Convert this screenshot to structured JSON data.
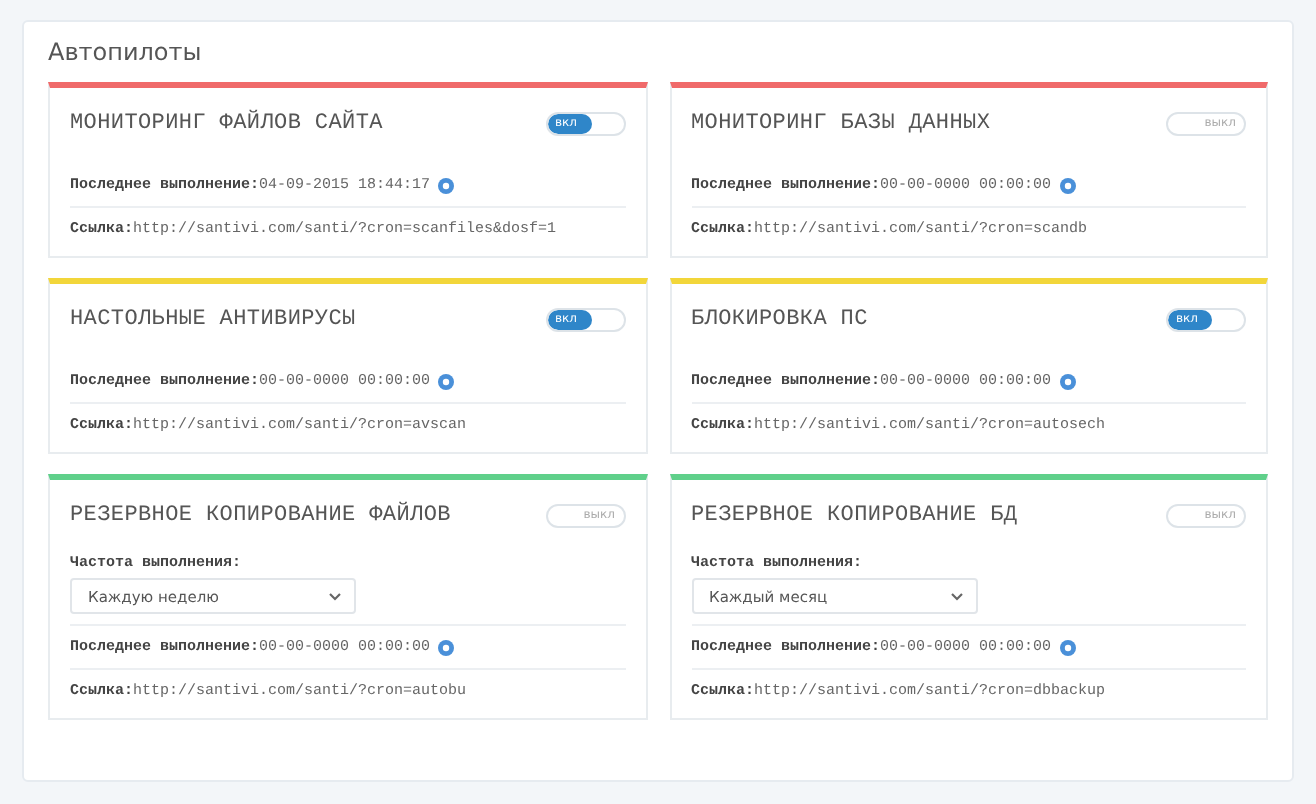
{
  "panel": {
    "title": "Автопилоты"
  },
  "cards": [
    {
      "title": "МОНИТОРИНГ ФАЙЛОВ САЙТА",
      "color": "#f06a6a",
      "toggle": {
        "on": true,
        "label": "вкл"
      },
      "last_run": {
        "label": "Последнее выполнение:",
        "value": "04-09-2015 18:44:17"
      },
      "link": {
        "label": "Ссылка:",
        "value": "http://santivi.com/santi/?cron=scanfiles&dosf=1"
      }
    },
    {
      "title": "МОНИТОРИНГ БАЗЫ ДАННЫХ",
      "color": "#f06a6a",
      "toggle": {
        "on": false,
        "label": "выкл"
      },
      "last_run": {
        "label": "Последнее выполнение:",
        "value": "00-00-0000 00:00:00"
      },
      "link": {
        "label": "Ссылка:",
        "value": "http://santivi.com/santi/?cron=scandb"
      }
    },
    {
      "title": "НАСТОЛЬНЫЕ АНТИВИРУСЫ",
      "color": "#f2d63a",
      "toggle": {
        "on": true,
        "label": "вкл"
      },
      "last_run": {
        "label": "Последнее выполнение:",
        "value": "00-00-0000 00:00:00"
      },
      "link": {
        "label": "Ссылка:",
        "value": "http://santivi.com/santi/?cron=avscan"
      }
    },
    {
      "title": "БЛОКИРОВКА ПС",
      "color": "#f2d63a",
      "toggle": {
        "on": true,
        "label": "вкл"
      },
      "last_run": {
        "label": "Последнее выполнение:",
        "value": "00-00-0000 00:00:00"
      },
      "link": {
        "label": "Ссылка:",
        "value": "http://santivi.com/santi/?cron=autosech"
      }
    },
    {
      "title": "РЕЗЕРВНОЕ КОПИРОВАНИЕ ФАЙЛОВ",
      "color": "#5fd08a",
      "toggle": {
        "on": false,
        "label": "выкл"
      },
      "frequency": {
        "label": "Частота выполнения:",
        "value": "Каждую неделю"
      },
      "last_run": {
        "label": "Последнее выполнение:",
        "value": "00-00-0000 00:00:00"
      },
      "link": {
        "label": "Ссылка:",
        "value": "http://santivi.com/santi/?cron=autobu"
      }
    },
    {
      "title": "РЕЗЕРВНОЕ КОПИРОВАНИЕ БД",
      "color": "#5fd08a",
      "toggle": {
        "on": false,
        "label": "выкл"
      },
      "frequency": {
        "label": "Частота выполнения:",
        "value": "Каждый месяц"
      },
      "last_run": {
        "label": "Последнее выполнение:",
        "value": "00-00-0000 00:00:00"
      },
      "link": {
        "label": "Ссылка:",
        "value": "http://santivi.com/santi/?cron=dbbackup"
      }
    }
  ]
}
